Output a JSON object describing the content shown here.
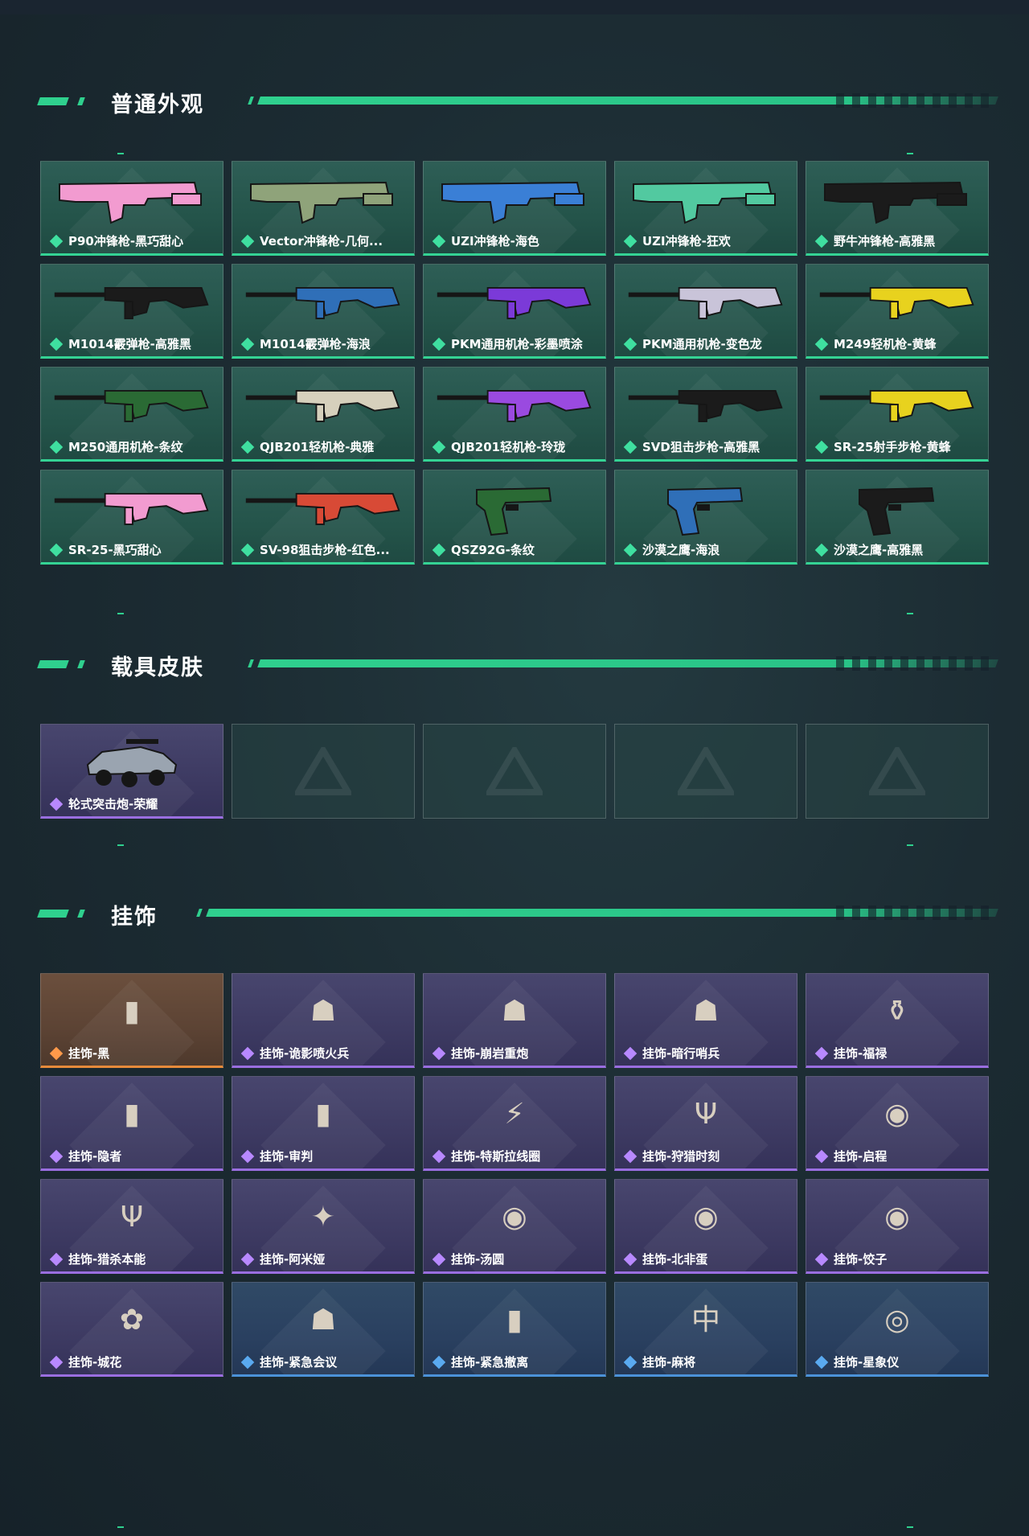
{
  "sections": {
    "weapons": {
      "title": "普通外观",
      "items": [
        {
          "label": "P90冲锋枪-黑巧甜心",
          "icon": "smg-icon",
          "accent": "#f29bd0"
        },
        {
          "label": "Vector冲锋枪-几何...",
          "icon": "smg-icon",
          "accent": "#8fa37a"
        },
        {
          "label": "UZI冲锋枪-海色",
          "icon": "smg-icon",
          "accent": "#3a7fd6"
        },
        {
          "label": "UZI冲锋枪-狂欢",
          "icon": "smg-icon",
          "accent": "#52c9a0"
        },
        {
          "label": "野牛冲锋枪-高雅黑",
          "icon": "smg-icon",
          "accent": "#1b1b1b"
        },
        {
          "label": "M1014霰弹枪-高雅黑",
          "icon": "shotgun-icon",
          "accent": "#1b1b1b"
        },
        {
          "label": "M1014霰弹枪-海浪",
          "icon": "shotgun-icon",
          "accent": "#2f6fb8"
        },
        {
          "label": "PKM通用机枪-彩墨喷涂",
          "icon": "machine-gun-icon",
          "accent": "#7b3ad8"
        },
        {
          "label": "PKM通用机枪-变色龙",
          "icon": "machine-gun-icon",
          "accent": "#c9c4d9"
        },
        {
          "label": "M249轻机枪-黄蜂",
          "icon": "machine-gun-icon",
          "accent": "#e8d21e"
        },
        {
          "label": "M250通用机枪-条纹",
          "icon": "machine-gun-icon",
          "accent": "#2a6a34"
        },
        {
          "label": "QJB201轻机枪-典雅",
          "icon": "machine-gun-icon",
          "accent": "#d6d0bc"
        },
        {
          "label": "QJB201轻机枪-玲珑",
          "icon": "machine-gun-icon",
          "accent": "#9a4ae0"
        },
        {
          "label": "SVD狙击步枪-高雅黑",
          "icon": "sniper-rifle-icon",
          "accent": "#1b1b1b"
        },
        {
          "label": "SR-25射手步枪-黄蜂",
          "icon": "sniper-rifle-icon",
          "accent": "#e8d21e"
        },
        {
          "label": "SR-25-黑巧甜心",
          "icon": "sniper-rifle-icon",
          "accent": "#f29bd0"
        },
        {
          "label": "SV-98狙击步枪-红色...",
          "icon": "sniper-rifle-icon",
          "accent": "#d84a36"
        },
        {
          "label": "QSZ92G-条纹",
          "icon": "pistol-icon",
          "accent": "#2a6a34"
        },
        {
          "label": "沙漠之鹰-海浪",
          "icon": "pistol-icon",
          "accent": "#2f6fb8"
        },
        {
          "label": "沙漠之鹰-高雅黑",
          "icon": "pistol-icon",
          "accent": "#1b1b1b"
        }
      ]
    },
    "vehicles": {
      "title": "载具皮肤",
      "items": [
        {
          "label": "轮式突击炮-荣耀",
          "icon": "vehicle-icon",
          "accent": "#9aa4b0"
        }
      ]
    },
    "charms": {
      "title": "挂饰",
      "items": [
        {
          "label": "挂饰-黑",
          "rarity": "orange",
          "icon": "charm-icon",
          "glyph": "▮"
        },
        {
          "label": "挂饰-诡影喷火兵",
          "rarity": "purple",
          "icon": "charm-icon",
          "glyph": "☗"
        },
        {
          "label": "挂饰-崩岩重炮",
          "rarity": "purple",
          "icon": "charm-icon",
          "glyph": "☗"
        },
        {
          "label": "挂饰-暗行哨兵",
          "rarity": "purple",
          "icon": "charm-icon",
          "glyph": "☗"
        },
        {
          "label": "挂饰-福禄",
          "rarity": "purple",
          "icon": "charm-icon",
          "glyph": "⚱"
        },
        {
          "label": "挂饰-隐者",
          "rarity": "purple",
          "icon": "charm-icon",
          "glyph": "▮"
        },
        {
          "label": "挂饰-审判",
          "rarity": "purple",
          "icon": "charm-icon",
          "glyph": "▮"
        },
        {
          "label": "挂饰-特斯拉线圈",
          "rarity": "purple",
          "icon": "charm-icon",
          "glyph": "⚡"
        },
        {
          "label": "挂饰-狩猎时刻",
          "rarity": "purple",
          "icon": "charm-icon",
          "glyph": "Ψ"
        },
        {
          "label": "挂饰-启程",
          "rarity": "purple",
          "icon": "charm-icon",
          "glyph": "◉"
        },
        {
          "label": "挂饰-猎杀本能",
          "rarity": "purple",
          "icon": "charm-icon",
          "glyph": "Ψ"
        },
        {
          "label": "挂饰-阿米娅",
          "rarity": "purple",
          "icon": "charm-icon",
          "glyph": "✦"
        },
        {
          "label": "挂饰-汤圆",
          "rarity": "purple",
          "icon": "charm-icon",
          "glyph": "◉"
        },
        {
          "label": "挂饰-北非蛋",
          "rarity": "purple",
          "icon": "charm-icon",
          "glyph": "◉"
        },
        {
          "label": "挂饰-饺子",
          "rarity": "purple",
          "icon": "charm-icon",
          "glyph": "◉"
        },
        {
          "label": "挂饰-城花",
          "rarity": "purple",
          "icon": "charm-icon",
          "glyph": "✿"
        },
        {
          "label": "挂饰-紧急会议",
          "rarity": "blue",
          "icon": "charm-icon",
          "glyph": "☗"
        },
        {
          "label": "挂饰-紧急撤离",
          "rarity": "blue",
          "icon": "charm-icon",
          "glyph": "▮"
        },
        {
          "label": "挂饰-麻将",
          "rarity": "blue",
          "icon": "charm-icon",
          "glyph": "中"
        },
        {
          "label": "挂饰-星象仪",
          "rarity": "blue",
          "icon": "charm-icon",
          "glyph": "◎"
        }
      ]
    }
  }
}
